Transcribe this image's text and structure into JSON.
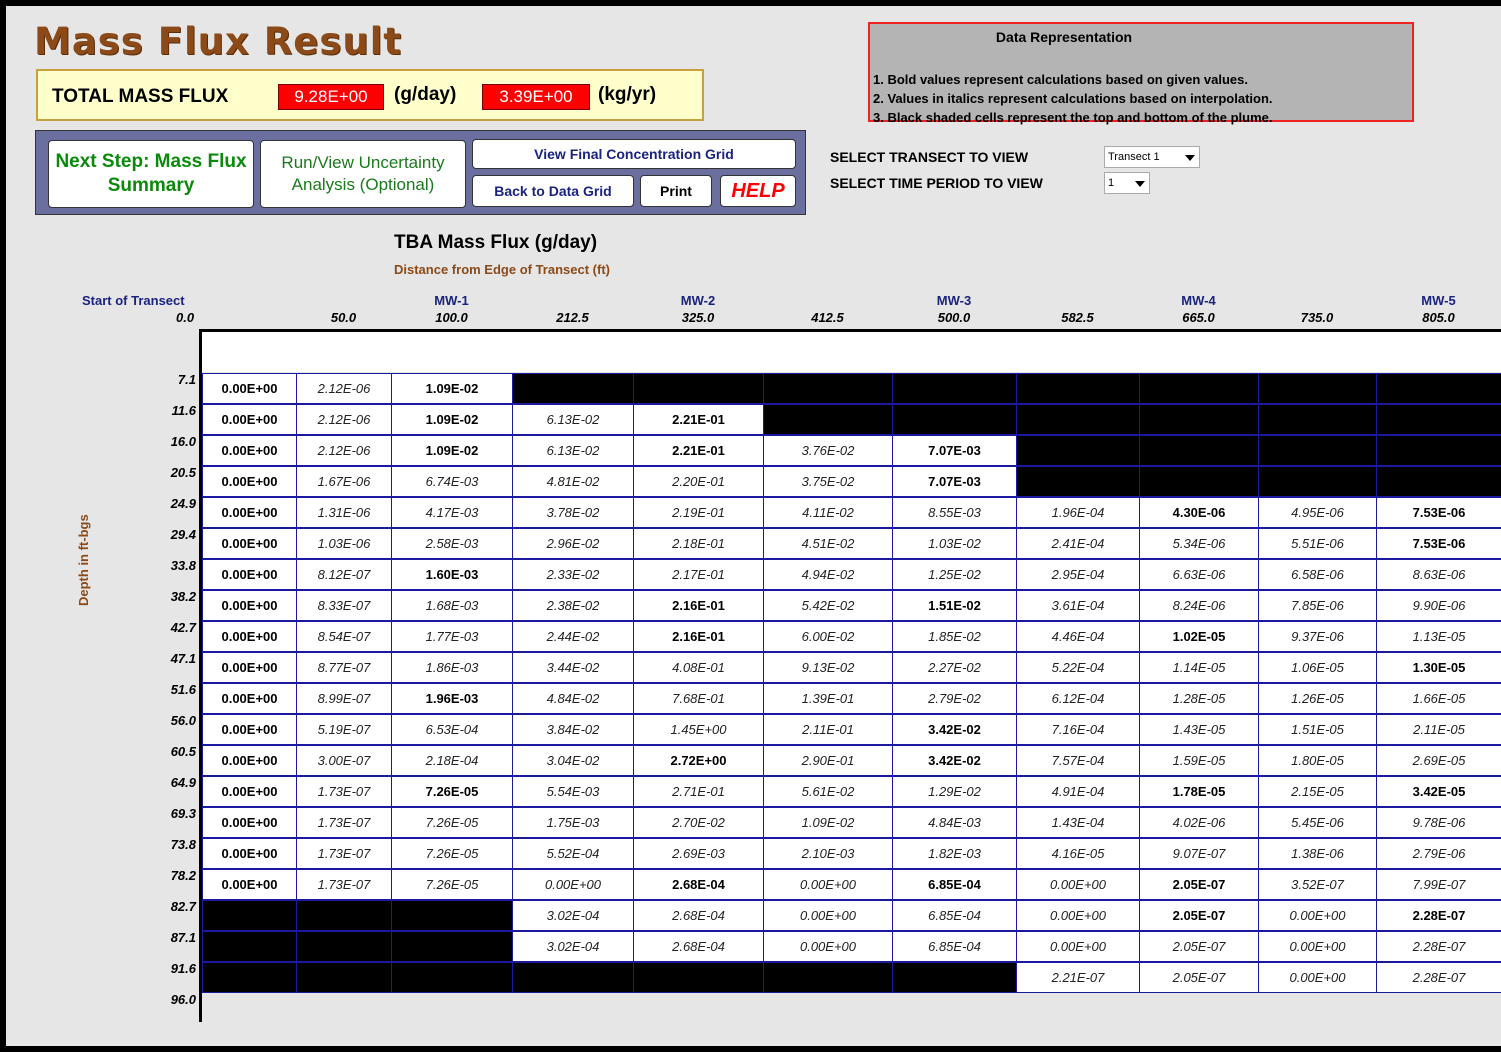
{
  "header": {
    "title": "Mass Flux Result",
    "total_label": "TOTAL MASS FLUX",
    "value_gday": "9.28E+00",
    "unit_gday": "(g/day)",
    "value_kgyr": "3.39E+00",
    "unit_kgyr": "(kg/yr)"
  },
  "buttons": {
    "next_step": "Next Step: Mass Flux Summary",
    "uncertainty": "Run/View Uncertainty Analysis (Optional)",
    "view_grid": "View Final Concentration Grid",
    "back": "Back to Data Grid",
    "print": "Print",
    "help": "HELP"
  },
  "representation": {
    "title": "Data Representation",
    "lines": [
      "1.  Bold values represent calculations based on given values.",
      "2.  Values in italics represent calculations based on interpolation.",
      "3.  Black shaded cells represent the top and bottom of the plume."
    ]
  },
  "selectors": {
    "transect_label": "SELECT TRANSECT TO VIEW",
    "transect_value": "Transect 1",
    "time_label": "SELECT TIME PERIOD TO VIEW",
    "time_value": "1"
  },
  "grid": {
    "title": "TBA Mass Flux (g/day)",
    "subtitle": "Distance from Edge of Transect (ft)",
    "start_label": "Start of Transect",
    "start_value": "0.0",
    "depth_label": "Depth in ft-bgs",
    "columns": [
      {
        "well": "",
        "dist": "50.0"
      },
      {
        "well": "MW-1",
        "dist": "100.0"
      },
      {
        "well": "",
        "dist": "212.5"
      },
      {
        "well": "MW-2",
        "dist": "325.0"
      },
      {
        "well": "",
        "dist": "412.5"
      },
      {
        "well": "MW-3",
        "dist": "500.0"
      },
      {
        "well": "",
        "dist": "582.5"
      },
      {
        "well": "MW-4",
        "dist": "665.0"
      },
      {
        "well": "",
        "dist": "735.0"
      },
      {
        "well": "MW-5",
        "dist": "805.0"
      }
    ],
    "depths": [
      "7.1",
      "11.6",
      "16.0",
      "20.5",
      "24.9",
      "29.4",
      "33.8",
      "38.2",
      "42.7",
      "47.1",
      "51.6",
      "56.0",
      "60.5",
      "64.9",
      "69.3",
      "73.8",
      "78.2",
      "82.7",
      "87.1",
      "91.6",
      "96.0"
    ],
    "rows": [
      [
        "b:0.00E+00",
        "i:2.12E-06",
        "b:1.09E-02",
        "k",
        "k",
        "k",
        "k",
        "k",
        "k",
        "k",
        "k"
      ],
      [
        "b:0.00E+00",
        "i:2.12E-06",
        "b:1.09E-02",
        "i:6.13E-02",
        "b:2.21E-01",
        "k",
        "k",
        "k",
        "k",
        "k",
        "k"
      ],
      [
        "b:0.00E+00",
        "i:2.12E-06",
        "b:1.09E-02",
        "i:6.13E-02",
        "b:2.21E-01",
        "i:3.76E-02",
        "b:7.07E-03",
        "k",
        "k",
        "k",
        "k"
      ],
      [
        "b:0.00E+00",
        "i:1.67E-06",
        "i:6.74E-03",
        "i:4.81E-02",
        "i:2.20E-01",
        "i:3.75E-02",
        "b:7.07E-03",
        "k",
        "k",
        "k",
        "k"
      ],
      [
        "b:0.00E+00",
        "i:1.31E-06",
        "i:4.17E-03",
        "i:3.78E-02",
        "i:2.19E-01",
        "i:4.11E-02",
        "i:8.55E-03",
        "i:1.96E-04",
        "b:4.30E-06",
        "i:4.95E-06",
        "b:7.53E-06"
      ],
      [
        "b:0.00E+00",
        "i:1.03E-06",
        "i:2.58E-03",
        "i:2.96E-02",
        "i:2.18E-01",
        "i:4.51E-02",
        "i:1.03E-02",
        "i:2.41E-04",
        "i:5.34E-06",
        "i:5.51E-06",
        "b:7.53E-06"
      ],
      [
        "b:0.00E+00",
        "i:8.12E-07",
        "b:1.60E-03",
        "i:2.33E-02",
        "i:2.17E-01",
        "i:4.94E-02",
        "i:1.25E-02",
        "i:2.95E-04",
        "i:6.63E-06",
        "i:6.58E-06",
        "i:8.63E-06"
      ],
      [
        "b:0.00E+00",
        "i:8.33E-07",
        "i:1.68E-03",
        "i:2.38E-02",
        "b:2.16E-01",
        "i:5.42E-02",
        "b:1.51E-02",
        "i:3.61E-04",
        "i:8.24E-06",
        "i:7.85E-06",
        "i:9.90E-06"
      ],
      [
        "b:0.00E+00",
        "i:8.54E-07",
        "i:1.77E-03",
        "i:2.44E-02",
        "b:2.16E-01",
        "i:6.00E-02",
        "i:1.85E-02",
        "i:4.46E-04",
        "b:1.02E-05",
        "i:9.37E-06",
        "i:1.13E-05"
      ],
      [
        "b:0.00E+00",
        "i:8.77E-07",
        "i:1.86E-03",
        "i:3.44E-02",
        "i:4.08E-01",
        "i:9.13E-02",
        "i:2.27E-02",
        "i:5.22E-04",
        "i:1.14E-05",
        "i:1.06E-05",
        "b:1.30E-05"
      ],
      [
        "b:0.00E+00",
        "i:8.99E-07",
        "b:1.96E-03",
        "i:4.84E-02",
        "i:7.68E-01",
        "i:1.39E-01",
        "i:2.79E-02",
        "i:6.12E-04",
        "i:1.28E-05",
        "i:1.26E-05",
        "i:1.66E-05"
      ],
      [
        "b:0.00E+00",
        "i:5.19E-07",
        "i:6.53E-04",
        "i:3.84E-02",
        "i:1.45E+00",
        "i:2.11E-01",
        "b:3.42E-02",
        "i:7.16E-04",
        "i:1.43E-05",
        "i:1.51E-05",
        "i:2.11E-05"
      ],
      [
        "b:0.00E+00",
        "i:3.00E-07",
        "i:2.18E-04",
        "i:3.04E-02",
        "b:2.72E+00",
        "i:2.90E-01",
        "b:3.42E-02",
        "i:7.57E-04",
        "i:1.59E-05",
        "i:1.80E-05",
        "i:2.69E-05"
      ],
      [
        "b:0.00E+00",
        "i:1.73E-07",
        "b:7.26E-05",
        "i:5.54E-03",
        "i:2.71E-01",
        "i:5.61E-02",
        "i:1.29E-02",
        "i:4.91E-04",
        "b:1.78E-05",
        "i:2.15E-05",
        "b:3.42E-05"
      ],
      [
        "b:0.00E+00",
        "i:1.73E-07",
        "i:7.26E-05",
        "i:1.75E-03",
        "i:2.70E-02",
        "i:1.09E-02",
        "i:4.84E-03",
        "i:1.43E-04",
        "i:4.02E-06",
        "i:5.45E-06",
        "i:9.78E-06"
      ],
      [
        "b:0.00E+00",
        "i:1.73E-07",
        "i:7.26E-05",
        "i:5.52E-04",
        "i:2.69E-03",
        "i:2.10E-03",
        "i:1.82E-03",
        "i:4.16E-05",
        "i:9.07E-07",
        "i:1.38E-06",
        "i:2.79E-06"
      ],
      [
        "b:0.00E+00",
        "i:1.73E-07",
        "i:7.26E-05",
        "i:0.00E+00",
        "b:2.68E-04",
        "i:0.00E+00",
        "b:6.85E-04",
        "i:0.00E+00",
        "b:2.05E-07",
        "i:3.52E-07",
        "i:7.99E-07"
      ],
      [
        "k",
        "k",
        "k",
        "i:3.02E-04",
        "i:2.68E-04",
        "i:0.00E+00",
        "i:6.85E-04",
        "i:0.00E+00",
        "b:2.05E-07",
        "i:0.00E+00",
        "b:2.28E-07"
      ],
      [
        "k",
        "k",
        "k",
        "i:3.02E-04",
        "i:2.68E-04",
        "i:0.00E+00",
        "i:6.85E-04",
        "i:0.00E+00",
        "i:2.05E-07",
        "i:0.00E+00",
        "i:2.28E-07"
      ],
      [
        "k",
        "k",
        "k",
        "k",
        "k",
        "k",
        "k",
        "i:2.21E-07",
        "i:2.05E-07",
        "i:0.00E+00",
        "i:2.28E-07"
      ]
    ]
  },
  "colors": {
    "title": "#8b4a17",
    "total_value_bg": "#ff0000",
    "nav_panel": "#6b6fa0",
    "next_step_text": "#0a8a0a",
    "help_text": "#ff0000",
    "grid_border": "#1a1aa0",
    "well_header": "#1a237e"
  },
  "icons": {
    "dropdown": "chevron-down-icon"
  }
}
